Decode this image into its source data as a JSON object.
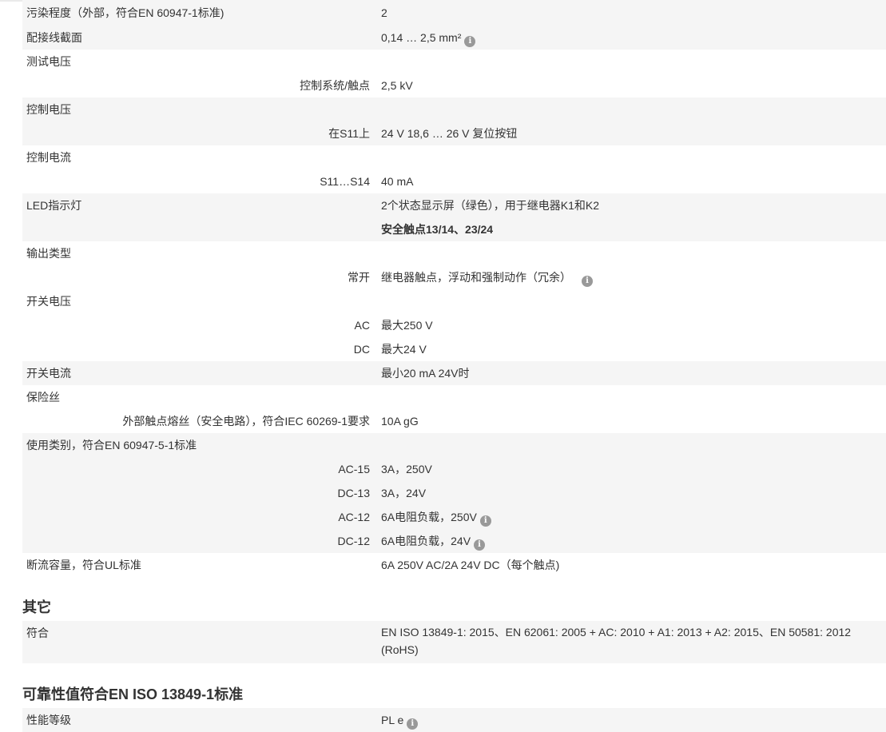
{
  "info_symbol": "i",
  "specs": [
    {
      "label": "污染程度（外部，符合EN 60947-1标准)",
      "value": "2"
    },
    {
      "label": "配接线截面",
      "value": "0,14 … 2,5 mm²"
    },
    {
      "label": "测试电压",
      "value": ""
    },
    {
      "label": "控制系统/触点",
      "value": "2,5 kV"
    },
    {
      "label": "控制电压",
      "value": ""
    },
    {
      "label": "在S11上",
      "value": "24 V 18,6 … 26 V 复位按钮"
    },
    {
      "label": "控制电流",
      "value": ""
    },
    {
      "label": "S11…S14",
      "value": "40 mA"
    },
    {
      "label": "LED指示灯",
      "value": "2个状态显示屏（绿色），用于继电器K1和K2"
    },
    {
      "label": "",
      "value": "安全触点13/14、23/24"
    },
    {
      "label": "输出类型",
      "value": ""
    },
    {
      "label": "常开",
      "value": "继电器触点，浮动和强制动作（冗余）"
    },
    {
      "label": "开关电压",
      "value": ""
    },
    {
      "label": "AC",
      "value": "最大250 V"
    },
    {
      "label": "DC",
      "value": "最大24 V"
    },
    {
      "label": "开关电流",
      "value": "最小20 mA 24V时"
    },
    {
      "label": "保险丝",
      "value": ""
    },
    {
      "label": "外部触点熔丝（安全电路），符合IEC 60269-1要求",
      "value": "10A gG"
    },
    {
      "label": "使用类别，符合EN 60947-5-1标准",
      "value": ""
    },
    {
      "label": "AC-15",
      "value": "3A，250V"
    },
    {
      "label": "DC-13",
      "value": "3A，24V"
    },
    {
      "label": "AC-12",
      "value": "6A电阻负载，250V"
    },
    {
      "label": "DC-12",
      "value": "6A电阻负载，24V"
    },
    {
      "label": "断流容量，符合UL标准",
      "value": "6A 250V AC/2A 24V DC（每个触点)"
    }
  ],
  "section_other": {
    "title": "其它",
    "rows": [
      {
        "label": "符合",
        "value": "EN ISO 13849-1: 2015、EN 62061: 2005 + AC: 2010 + A1: 2013 + A2: 2015、EN 50581: 2012 (RoHS)"
      }
    ]
  },
  "section_reliability": {
    "title": "可靠性值符合EN ISO 13849-1标准",
    "rows": [
      {
        "label": "性能等级",
        "value": "PL e"
      }
    ]
  }
}
